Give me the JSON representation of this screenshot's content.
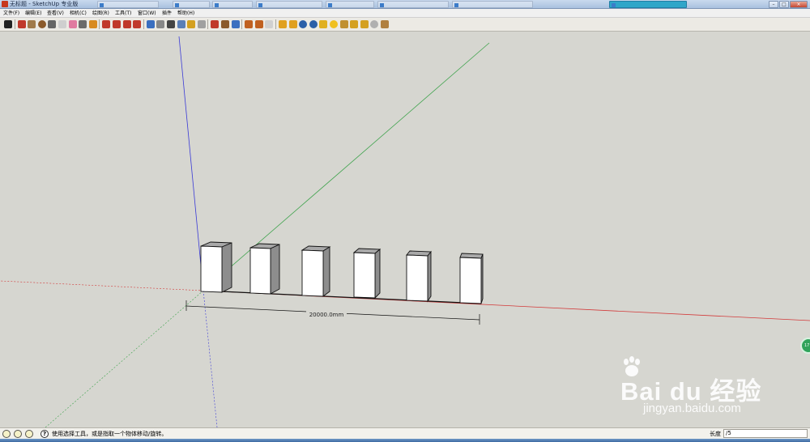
{
  "window": {
    "title": "无标题 - SketchUp 专业版",
    "background_tabs": [
      {
        "label": "",
        "active": false
      },
      {
        "label": "",
        "active": false
      },
      {
        "label": "",
        "active": false
      },
      {
        "label": "",
        "active": false
      },
      {
        "label": "",
        "active": false
      },
      {
        "label": "",
        "active": false
      },
      {
        "label": "",
        "active": false
      },
      {
        "label": "",
        "active": true
      }
    ],
    "controls": {
      "minimize": "–",
      "maximize": "□",
      "close": "×"
    }
  },
  "menu": {
    "items": [
      "文件(F)",
      "编辑(E)",
      "查看(V)",
      "相机(C)",
      "绘图(R)",
      "工具(T)",
      "窗口(W)",
      "插件",
      "帮助(H)"
    ]
  },
  "toolbar": {
    "tools": [
      {
        "name": "select-tool",
        "icon": "arrow-cursor-icon",
        "color": "#222222"
      },
      {
        "name": "line-tool",
        "icon": "pencil-icon",
        "color": "#c0392b"
      },
      {
        "name": "rectangle-tool",
        "icon": "rectangle-icon",
        "color": "#a07a4a"
      },
      {
        "name": "circle-tool",
        "icon": "circle-icon",
        "color": "#8b5a2b"
      },
      {
        "name": "arc-tool",
        "icon": "arc-icon",
        "color": "#666666"
      },
      {
        "name": "make-component-tool",
        "icon": "component-icon",
        "color": "#cfcfcf"
      },
      {
        "name": "eraser-tool",
        "icon": "eraser-icon",
        "color": "#e07aa0"
      },
      {
        "name": "tape-measure-tool",
        "icon": "tape-measure-icon",
        "color": "#6b6b6b"
      },
      {
        "name": "paint-bucket-tool",
        "icon": "paint-bucket-icon",
        "color": "#d88a20"
      },
      {
        "name": "push-pull-tool",
        "icon": "push-pull-icon",
        "color": "#c0392b"
      },
      {
        "name": "move-tool",
        "icon": "move-icon",
        "color": "#c0392b"
      },
      {
        "name": "rotate-tool",
        "icon": "rotate-icon",
        "color": "#c0392b"
      },
      {
        "name": "offset-tool",
        "icon": "offset-icon",
        "color": "#c0392b"
      },
      {
        "name": "orbit-tool",
        "icon": "orbit-icon",
        "color": "#3a6fc0"
      },
      {
        "name": "pan-tool",
        "icon": "hand-icon",
        "color": "#888888"
      },
      {
        "name": "zoom-tool",
        "icon": "magnifier-icon",
        "color": "#444444"
      },
      {
        "name": "zoom-extents-tool",
        "icon": "zoom-extents-icon",
        "color": "#5a7fb8"
      },
      {
        "name": "previous-view-tool",
        "icon": "previous-view-icon",
        "color": "#d4a020"
      },
      {
        "name": "next-view-tool",
        "icon": "next-view-icon",
        "color": "#a0a0a0"
      },
      {
        "name": "position-camera-tool",
        "icon": "camera-icon",
        "color": "#c0392b"
      },
      {
        "name": "walk-tool",
        "icon": "walk-icon",
        "color": "#8b5a2b"
      },
      {
        "name": "look-around-tool",
        "icon": "eye-icon",
        "color": "#3a6fc0"
      },
      {
        "name": "get-models-tool",
        "icon": "get-models-icon",
        "color": "#c06020"
      },
      {
        "name": "share-model-tool",
        "icon": "share-model-icon",
        "color": "#c06020"
      },
      {
        "name": "share-component-tool",
        "icon": "share-component-icon",
        "color": "#d0d0d0"
      },
      {
        "name": "extension-tool-1",
        "icon": "ruby-icon",
        "color": "#e0a020"
      },
      {
        "name": "extension-tool-2",
        "icon": "ruby-icon",
        "color": "#e0a020"
      },
      {
        "name": "extension-tool-3",
        "icon": "globe-icon",
        "color": "#2a5fa8"
      },
      {
        "name": "extension-tool-4",
        "icon": "globe-icon",
        "color": "#2a5fa8"
      },
      {
        "name": "extension-tool-5",
        "icon": "tag-icon",
        "color": "#e0b020"
      },
      {
        "name": "extension-tool-6",
        "icon": "sun-icon",
        "color": "#f0c020"
      },
      {
        "name": "extension-tool-7",
        "icon": "pin-icon",
        "color": "#c09030"
      },
      {
        "name": "extension-tool-8",
        "icon": "flag-icon",
        "color": "#d4a020"
      },
      {
        "name": "extension-tool-9",
        "icon": "bird-icon",
        "color": "#d4a020"
      },
      {
        "name": "extension-tool-10",
        "icon": "sphere-icon",
        "color": "#b0b0b0"
      },
      {
        "name": "extension-tool-11",
        "icon": "wand-icon",
        "color": "#b08040"
      }
    ]
  },
  "model": {
    "dimension_label": "20000.0mm",
    "colors": {
      "background": "#d6d6d0",
      "red_axis": "#d23a3a",
      "green_axis": "#3fa34d",
      "blue_axis": "#3a3ad6",
      "face_front": "#ffffff",
      "face_side": "#8d8d8d",
      "face_top": "#a9a9a9",
      "edge": "#111111"
    }
  },
  "watermark": {
    "main": "Bai du 经验",
    "sub": "jingyan.baidu.com"
  },
  "side_badge": "17",
  "statusbar": {
    "message": "使用选择工具，或是指取一个物体移动/旋转。",
    "measurement_label": "长度",
    "measurement_value": "/5"
  }
}
